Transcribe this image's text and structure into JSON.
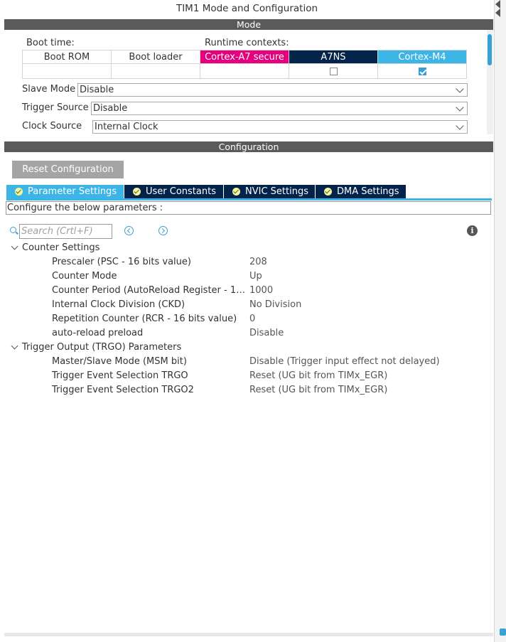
{
  "window": {
    "title": "TIM1 Mode and Configuration"
  },
  "mode": {
    "header": "Mode",
    "boot_time_label": "Boot time:",
    "runtime_contexts_label": "Runtime contexts:",
    "contexts": {
      "boot_rom": "Boot ROM",
      "boot_loader": "Boot loader",
      "cortex_a7_secure": "Cortex-A7 secure",
      "a7ns": "A7NS",
      "cortex_m4": "Cortex-M4"
    },
    "context_checked": {
      "a7ns": false,
      "cortex_m4": true
    },
    "slave_mode": {
      "label": "Slave Mode",
      "value": "Disable"
    },
    "trigger_source": {
      "label": "Trigger Source",
      "value": "Disable"
    },
    "clock_source": {
      "label": "Clock Source",
      "value": "Internal Clock"
    }
  },
  "configuration": {
    "header": "Configuration",
    "reset_button": "Reset Configuration",
    "tabs": [
      {
        "label": "Parameter Settings",
        "active": true
      },
      {
        "label": "User Constants",
        "active": false
      },
      {
        "label": "NVIC Settings",
        "active": false
      },
      {
        "label": "DMA Settings",
        "active": false
      }
    ],
    "description": "Configure the below parameters :",
    "search": {
      "placeholder": "Search (Crtl+F)",
      "value": ""
    },
    "groups": [
      {
        "label": "Counter Settings",
        "params": [
          {
            "name": "Prescaler (PSC - 16 bits value)",
            "value": "208"
          },
          {
            "name": "Counter Mode",
            "value": "Up"
          },
          {
            "name": "Counter Period (AutoReload Register - 16...",
            "value": "1000"
          },
          {
            "name": "Internal Clock Division (CKD)",
            "value": "No Division"
          },
          {
            "name": "Repetition Counter (RCR - 16 bits value)",
            "value": "0"
          },
          {
            "name": "auto-reload preload",
            "value": "Disable"
          }
        ]
      },
      {
        "label": "Trigger Output (TRGO) Parameters",
        "params": [
          {
            "name": "Master/Slave Mode (MSM bit)",
            "value": "Disable (Trigger input effect not delayed)"
          },
          {
            "name": "Trigger Event Selection TRGO",
            "value": "Reset (UG bit from TIMx_EGR)"
          },
          {
            "name": "Trigger Event Selection TRGO2",
            "value": "Reset (UG bit from TIMx_EGR)"
          }
        ]
      }
    ]
  },
  "colors": {
    "cortex_a7_secure": "#e4007d",
    "a7ns": "#03234b",
    "cortex_m4": "#3cb4e5",
    "section_bar": "#5a5a5a"
  }
}
